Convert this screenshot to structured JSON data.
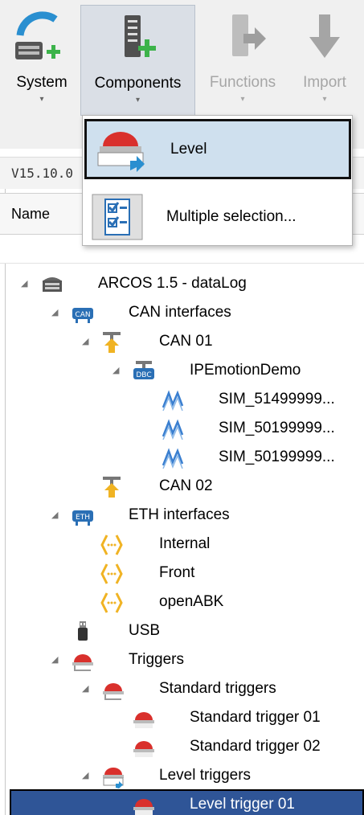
{
  "ribbon": {
    "system": {
      "label": "System",
      "caret": "▾"
    },
    "components": {
      "label": "Components",
      "caret": "▾"
    },
    "functions": {
      "label": "Functions",
      "caret": "▾"
    },
    "import": {
      "label": "Import",
      "caret": "▾"
    }
  },
  "version_label": "V15.10.0",
  "column_header": "Name",
  "dropdown": {
    "items": [
      {
        "label": "Level",
        "icon": "level-trigger-icon"
      },
      {
        "label": "Multiple selection...",
        "icon": "multiple-selection-icon"
      }
    ]
  },
  "tree": [
    {
      "label": "ARCOS 1.5 - dataLog",
      "icon": "logger-device-icon"
    },
    {
      "label": "CAN interfaces",
      "icon": "can-bus-icon"
    },
    {
      "label": "CAN 01",
      "icon": "can-port-icon"
    },
    {
      "label": "IPEmotionDemo",
      "icon": "dbc-icon"
    },
    {
      "label": "SIM_51499999...",
      "icon": "signal-icon"
    },
    {
      "label": "SIM_50199999...",
      "icon": "signal-icon"
    },
    {
      "label": "SIM_50199999...",
      "icon": "signal-icon"
    },
    {
      "label": "CAN 02",
      "icon": "can-port-icon"
    },
    {
      "label": "ETH interfaces",
      "icon": "eth-icon"
    },
    {
      "label": "Internal",
      "icon": "eth-port-icon"
    },
    {
      "label": "Front",
      "icon": "eth-port-icon"
    },
    {
      "label": "openABK",
      "icon": "eth-port-icon"
    },
    {
      "label": "USB",
      "icon": "usb-icon"
    },
    {
      "label": "Triggers",
      "icon": "trigger-icon"
    },
    {
      "label": "Standard triggers",
      "icon": "trigger-icon"
    },
    {
      "label": "Standard trigger 01",
      "icon": "trigger-icon"
    },
    {
      "label": "Standard trigger 02",
      "icon": "trigger-icon"
    },
    {
      "label": "Level triggers",
      "icon": "level-trigger-icon"
    },
    {
      "label": "Level trigger 01",
      "icon": "trigger-icon"
    }
  ],
  "colors": {
    "selection": "#2f5597",
    "menu_highlight": "#cfe0ee",
    "accent_green": "#3cb34a",
    "trigger_red": "#d9302c"
  }
}
